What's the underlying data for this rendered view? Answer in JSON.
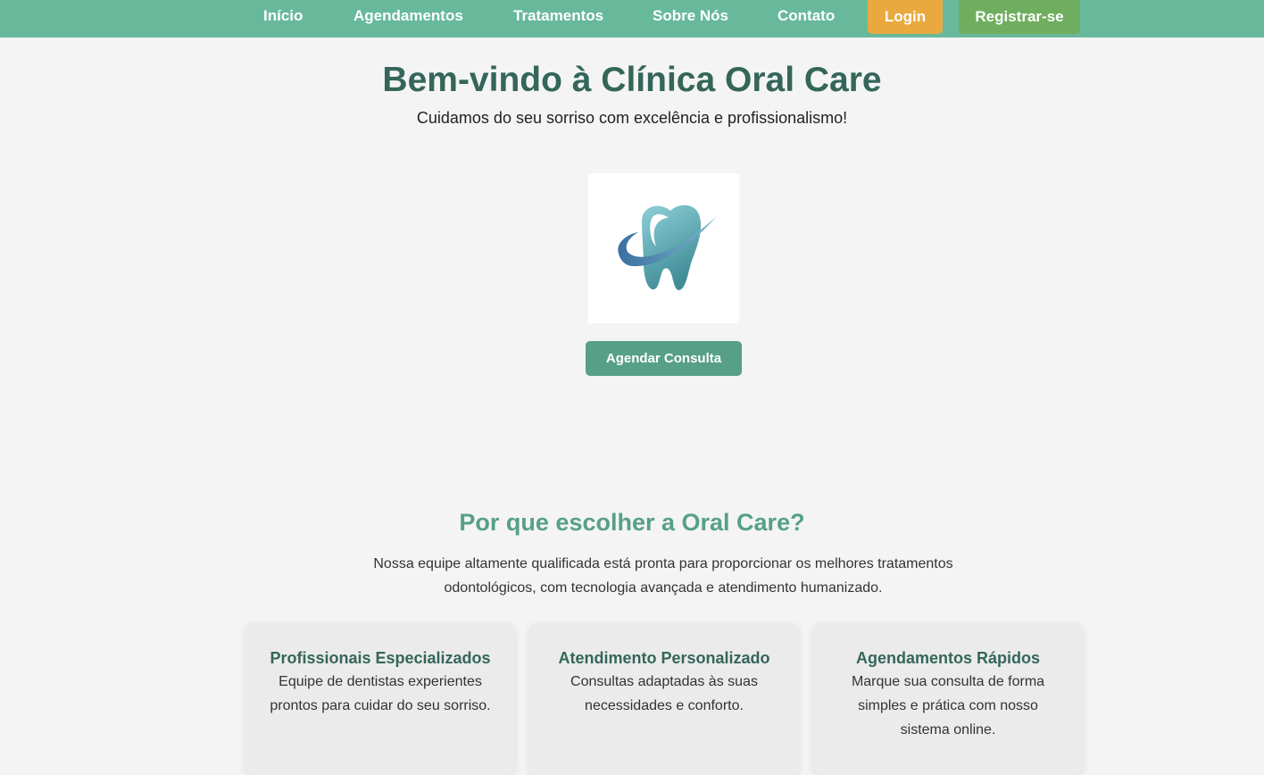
{
  "nav": {
    "links": [
      "Início",
      "Agendamentos",
      "Tratamentos",
      "Sobre Nós",
      "Contato"
    ],
    "login": "Login",
    "register": "Registrar-se"
  },
  "hero": {
    "title": "Bem-vindo à Clínica Oral Care",
    "subtitle": "Cuidamos do seu sorriso com excelência e profissionalismo!",
    "cta": "Agendar Consulta",
    "logo_icon": "tooth-logo-icon"
  },
  "why": {
    "title": "Por que escolher a Oral Care?",
    "text": "Nossa equipe altamente qualificada está pronta para proporcionar os melhores tratamentos odontológicos, com tecnologia avançada e atendimento humanizado."
  },
  "cards": [
    {
      "title": "Profissionais Especializados",
      "text": "Equipe de dentistas experientes prontos para cuidar do seu sorriso."
    },
    {
      "title": "Atendimento Personalizado",
      "text": "Consultas adaptadas às suas necessidades e conforto."
    },
    {
      "title": "Agendamentos Rápidos",
      "text": "Marque sua consulta de forma simples e prática com nosso sistema online."
    }
  ],
  "colors": {
    "nav_bg": "#68b99c",
    "login_btn": "#e9a93f",
    "register_btn": "#6fae5e",
    "cta_btn": "#57a087",
    "title": "#346659"
  }
}
